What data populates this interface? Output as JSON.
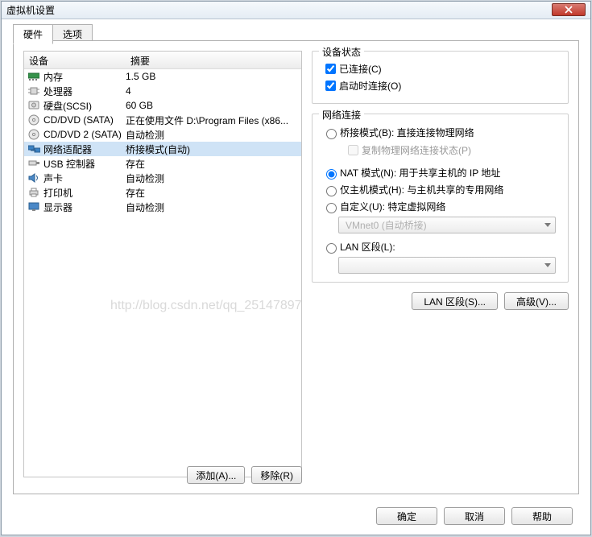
{
  "window": {
    "title": "虚拟机设置"
  },
  "tabs": {
    "hardware": "硬件",
    "options": "选项"
  },
  "hw_headers": {
    "device": "设备",
    "summary": "摘要"
  },
  "hw_items": [
    {
      "icon": "memory-icon",
      "name": "内存",
      "summary": "1.5 GB"
    },
    {
      "icon": "cpu-icon",
      "name": "处理器",
      "summary": "4"
    },
    {
      "icon": "disk-icon",
      "name": "硬盘(SCSI)",
      "summary": "60 GB"
    },
    {
      "icon": "cd-icon",
      "name": "CD/DVD (SATA)",
      "summary": "正在使用文件 D:\\Program Files (x86..."
    },
    {
      "icon": "cd-icon",
      "name": "CD/DVD 2 (SATA)",
      "summary": "自动检测"
    },
    {
      "icon": "network-icon",
      "name": "网络适配器",
      "summary": "桥接模式(自动)"
    },
    {
      "icon": "usb-icon",
      "name": "USB 控制器",
      "summary": "存在"
    },
    {
      "icon": "sound-icon",
      "name": "声卡",
      "summary": "自动检测"
    },
    {
      "icon": "printer-icon",
      "name": "打印机",
      "summary": "存在"
    },
    {
      "icon": "monitor-icon",
      "name": "显示器",
      "summary": "自动检测"
    }
  ],
  "hw_selected_index": 5,
  "hw_buttons": {
    "add": "添加(A)...",
    "remove": "移除(R)"
  },
  "status_group": {
    "legend": "设备状态",
    "connected": {
      "label": "已连接(C)",
      "checked": true
    },
    "connect_at_power": {
      "label": "启动时连接(O)",
      "checked": true
    }
  },
  "net_group": {
    "legend": "网络连接",
    "bridged": {
      "label": "桥接模式(B): 直接连接物理网络"
    },
    "replicate": {
      "label": "复制物理网络连接状态(P)"
    },
    "nat": {
      "label": "NAT 模式(N): 用于共享主机的 IP 地址"
    },
    "hostonly": {
      "label": "仅主机模式(H): 与主机共享的专用网络"
    },
    "custom": {
      "label": "自定义(U): 特定虚拟网络"
    },
    "custom_select": "VMnet0 (自动桥接)",
    "lan": {
      "label": "LAN 区段(L):"
    },
    "lan_select": "",
    "selected": "nat"
  },
  "net_buttons": {
    "lan_segments": "LAN 区段(S)...",
    "advanced": "高级(V)..."
  },
  "footer": {
    "ok": "确定",
    "cancel": "取消",
    "help": "帮助"
  },
  "watermark": "http://blog.csdn.net/qq_25147897"
}
